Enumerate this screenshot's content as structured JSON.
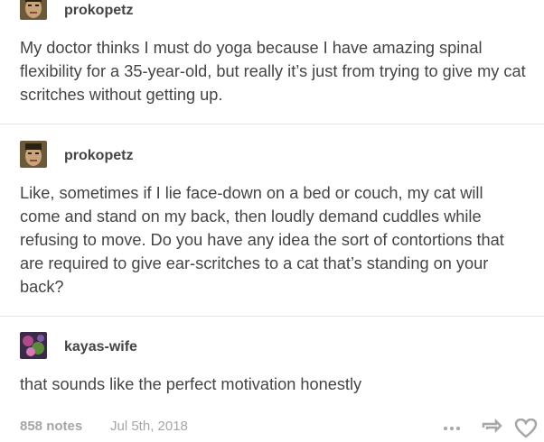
{
  "posts": [
    {
      "username": "prokopetz",
      "text": "My doctor thinks I must do yoga because I have amazing spinal flexibility for a 35-year-old, but really it’s just from trying to give my cat scritches without getting up."
    },
    {
      "username": "prokopetz",
      "text": "Like, sometimes if I lie face-down on a bed or couch, my cat will come and stand on my back, then loudly demand cuddles while refusing to move. Do you have any idea the sort of contortions that are required to give ear-scritches to a cat that’s standing on your back?"
    },
    {
      "username": "kayas-wife",
      "text": "that sounds like the perfect motivation honestly"
    }
  ],
  "footer": {
    "notes": "858 notes",
    "date": "Jul 5th, 2018",
    "icons": [
      "more-icon",
      "reblog-icon",
      "like-icon"
    ]
  }
}
